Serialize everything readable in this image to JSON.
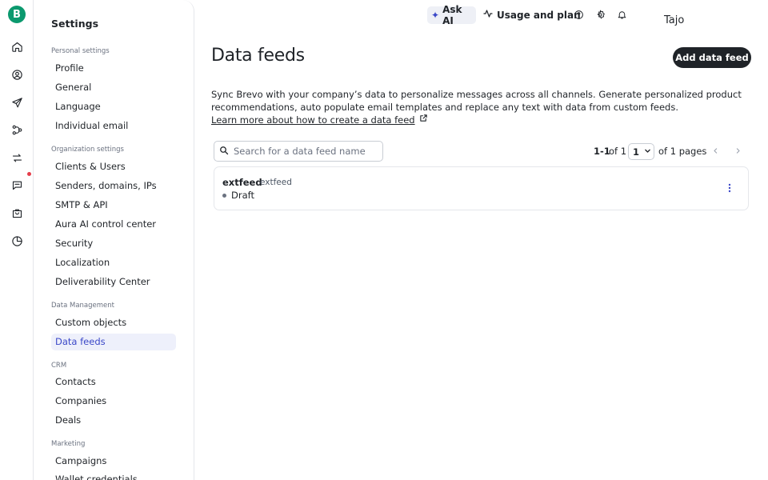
{
  "rail": {
    "logo": "B",
    "icons": [
      "home-icon",
      "contacts-icon",
      "campaigns-icon",
      "automation-icon",
      "transactional-icon",
      "conversations-icon",
      "sales-icon",
      "reports-icon"
    ]
  },
  "sidebar": {
    "title": "Settings",
    "groups": [
      {
        "label": "Personal settings",
        "items": [
          "Profile",
          "General",
          "Language",
          "Individual email"
        ]
      },
      {
        "label": "Organization settings",
        "items": [
          "Clients & Users",
          "Senders, domains, IPs",
          "SMTP & API",
          "Aura AI control center",
          "Security",
          "Localization",
          "Deliverability Center"
        ]
      },
      {
        "label": "Data Management",
        "items": [
          "Custom objects",
          "Data feeds"
        ]
      },
      {
        "label": "CRM",
        "items": [
          "Contacts",
          "Companies",
          "Deals"
        ]
      },
      {
        "label": "Marketing",
        "items": [
          "Campaigns",
          "Wallet credentials"
        ]
      }
    ],
    "active": "Data feeds"
  },
  "topbar": {
    "ask_ai": "Ask AI",
    "usage": "Usage and plan",
    "user": "Tajo"
  },
  "main": {
    "title": "Data feeds",
    "add_button": "Add data feed",
    "description": "Sync Brevo with your company’s data to personalize messages across all channels. Generate personalized product recommendations, auto populate email templates and replace any text with data from custom feeds.",
    "learn_more": "Learn more about how to create a data feed",
    "search_placeholder": "Search for a data feed name",
    "pager": {
      "range": "1-1",
      "of_total": "of 1",
      "page": "1",
      "pages": "of 1 pages"
    },
    "feeds": [
      {
        "name": "extfeed",
        "type": "extfeed",
        "status": "Draft"
      }
    ]
  },
  "colors": {
    "brand": "#0b996e",
    "accent": "#3b48c8",
    "dark_button": "#1f2328",
    "notification": "#e53e4b"
  }
}
